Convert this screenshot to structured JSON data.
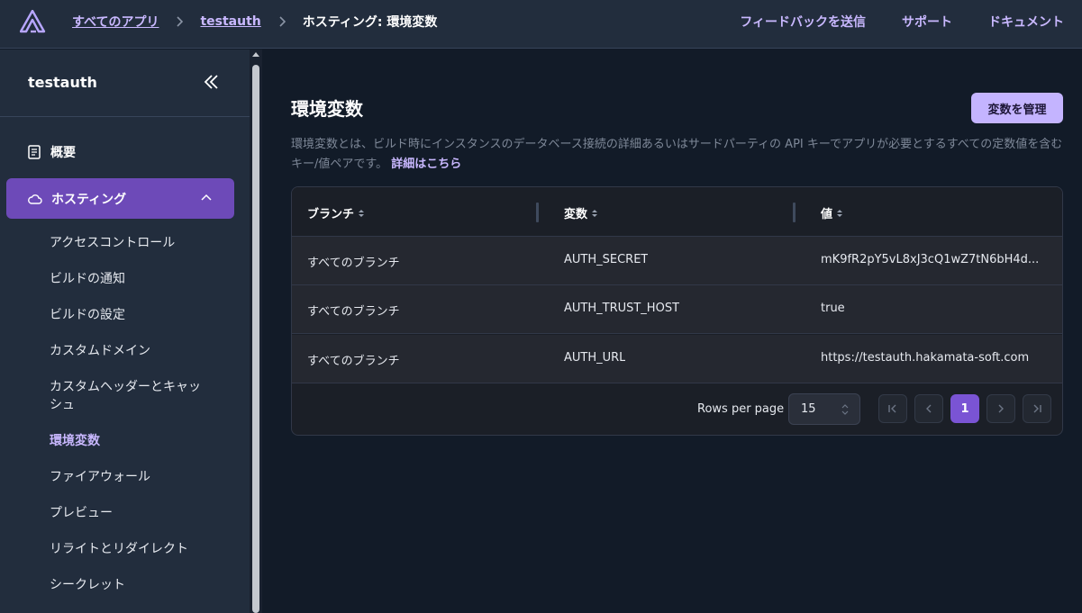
{
  "header": {
    "breadcrumbs": [
      "すべてのアプリ",
      "testauth",
      "ホスティング: 環境変数"
    ],
    "links": [
      "フィードバックを送信",
      "サポート",
      "ドキュメント"
    ]
  },
  "sidebar": {
    "app_name": "testauth",
    "overview": "概要",
    "hosting": "ホスティング",
    "sub_items": [
      "アクセスコントロール",
      "ビルドの通知",
      "ビルドの設定",
      "カスタムドメイン",
      "カスタムヘッダーとキャッシュ",
      "環境変数",
      "ファイアウォール",
      "プレビュー",
      "リライトとリダイレクト",
      "シークレット"
    ],
    "active_item": "環境変数"
  },
  "main": {
    "title": "環境変数",
    "manage_button": "変数を管理",
    "description": "環境変数とは、ビルド時にインスタンスのデータベース接続の詳細あるいはサードパーティの API キーでアプリが必要とするすべての定数値を含むキー/値ペアです。",
    "learn_more": "詳細はこちら"
  },
  "table": {
    "columns": [
      "ブランチ",
      "変数",
      "値"
    ],
    "rows": [
      [
        "すべてのブランチ",
        "AUTH_SECRET",
        "mK9fR2pY5vL8xJ3cQ1wZ7tN6bH4d..."
      ],
      [
        "すべてのブランチ",
        "AUTH_TRUST_HOST",
        "true"
      ],
      [
        "すべてのブランチ",
        "AUTH_URL",
        "https://testauth.hakamata-soft.com"
      ]
    ],
    "rows_per_page_label": "Rows per page",
    "rows_per_page": "15",
    "current_page": "1"
  },
  "colors": {
    "accent": "#6d4ab8",
    "link": "#c9b8ff",
    "button": "#c4b4ff",
    "page_active": "#7a54d4"
  }
}
